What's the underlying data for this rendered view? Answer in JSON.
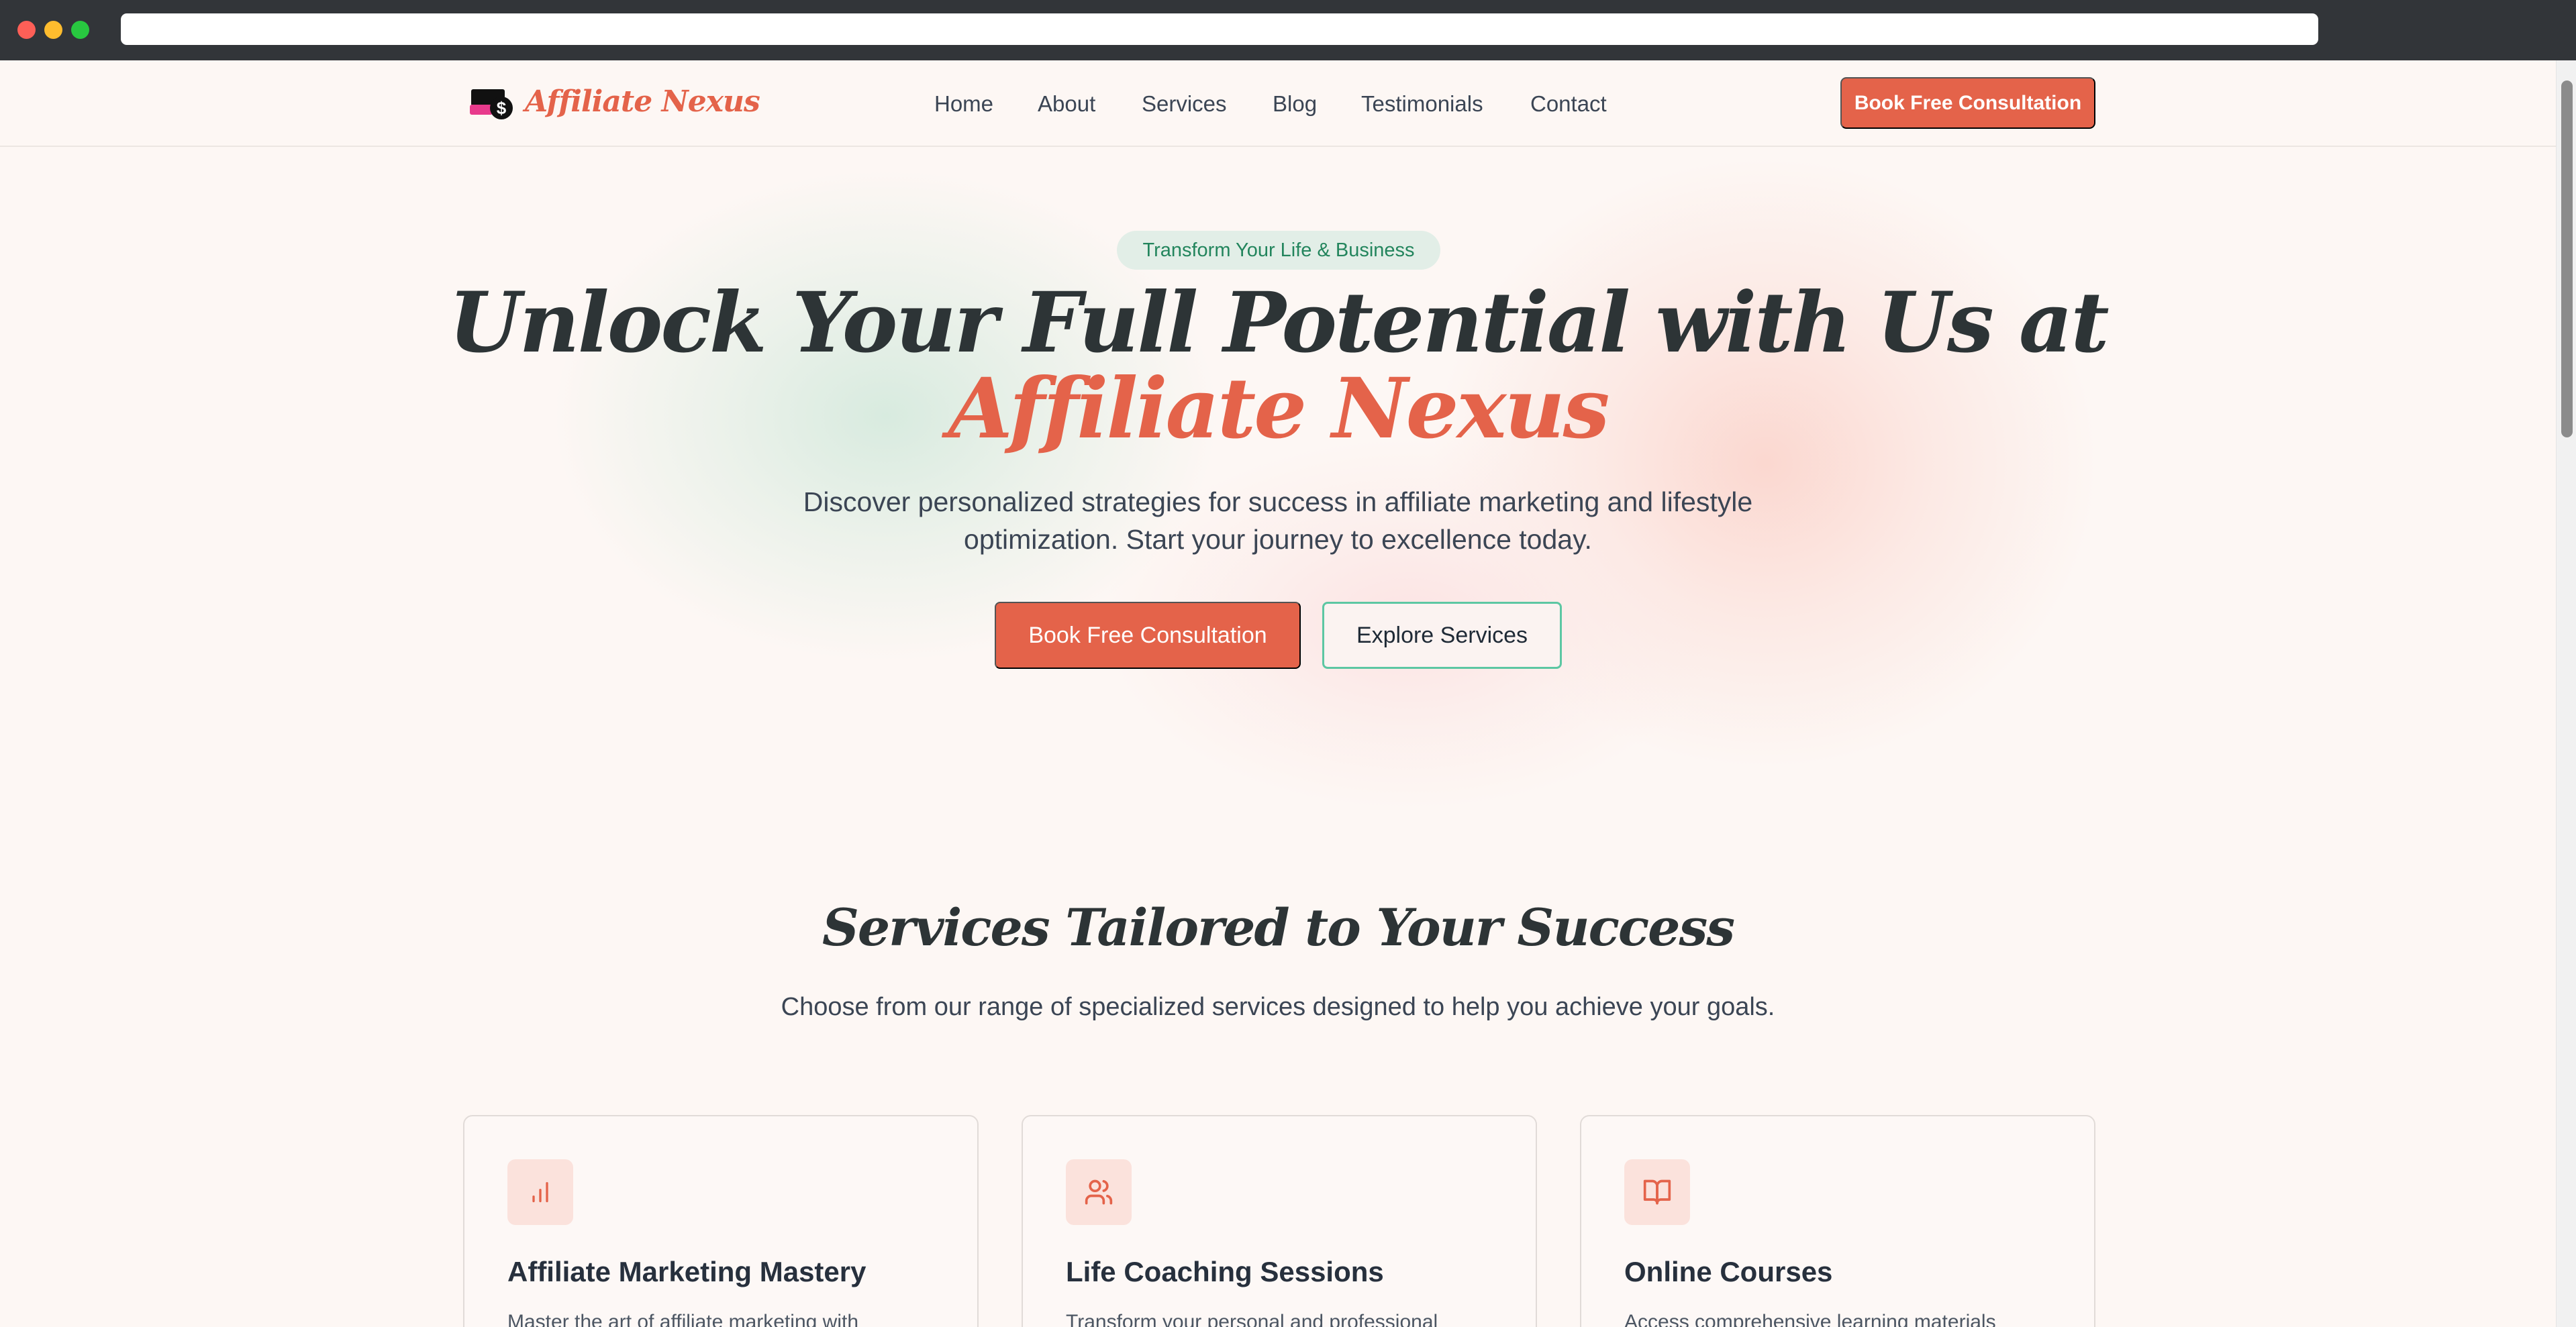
{
  "brand": {
    "name": "Affiliate Nexus",
    "accent_color": "#e4634a",
    "secondary_color": "#23855d"
  },
  "nav": {
    "links": [
      "Home",
      "About",
      "Services",
      "Blog",
      "Testimonials",
      "Contact"
    ],
    "cta_label": "Book Free Consultation"
  },
  "hero": {
    "badge": "Transform Your Life & Business",
    "title_line1": "Unlock Your Full Potential with Us at",
    "title_line2": "Affiliate Nexus",
    "subtitle": "Discover personalized strategies for success in affiliate marketing and lifestyle optimization. Start your journey to excellence today.",
    "primary_cta": "Book Free Consultation",
    "secondary_cta": "Explore Services"
  },
  "services": {
    "title": "Services Tailored to Your Success",
    "subtitle": "Choose from our range of specialized services designed to help you achieve your goals.",
    "cards": [
      {
        "title": "Affiliate Marketing Mastery",
        "icon": "bar-chart-icon",
        "description": "Master the art of affiliate marketing with"
      },
      {
        "title": "Life Coaching Sessions",
        "icon": "users-icon",
        "description": "Transform your personal and professional"
      },
      {
        "title": "Online Courses",
        "icon": "book-open-icon",
        "description": "Access comprehensive learning materials"
      }
    ]
  }
}
